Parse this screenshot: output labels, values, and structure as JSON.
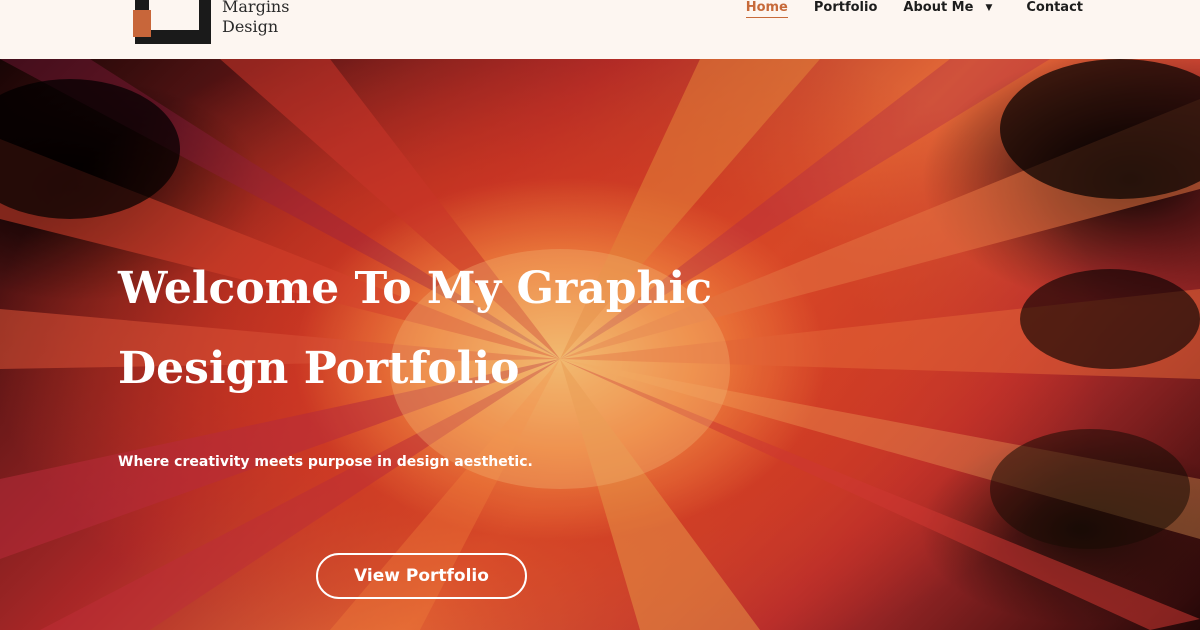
{
  "brand": {
    "logo_icon": "logo-square-mark",
    "name_line1": "Margins",
    "name_line2": "Design",
    "logo_colors": {
      "dark": "#1a1a1a",
      "accent": "#c8663a"
    }
  },
  "nav": {
    "items": [
      {
        "label": "Home",
        "active": true
      },
      {
        "label": "Portfolio",
        "active": false
      },
      {
        "label": "About Me",
        "active": false,
        "icon": "caret-down-icon"
      },
      {
        "label": "Contact",
        "active": false
      }
    ],
    "active_color": "#c76a3a"
  },
  "hero": {
    "background": "color-powder-explosion-image",
    "title_line1": "Welcome To My Graphic",
    "title_line2": "Design Portfolio",
    "subtitle": "Where creativity meets purpose in design aesthetic.",
    "cta_label": "View Portfolio"
  }
}
